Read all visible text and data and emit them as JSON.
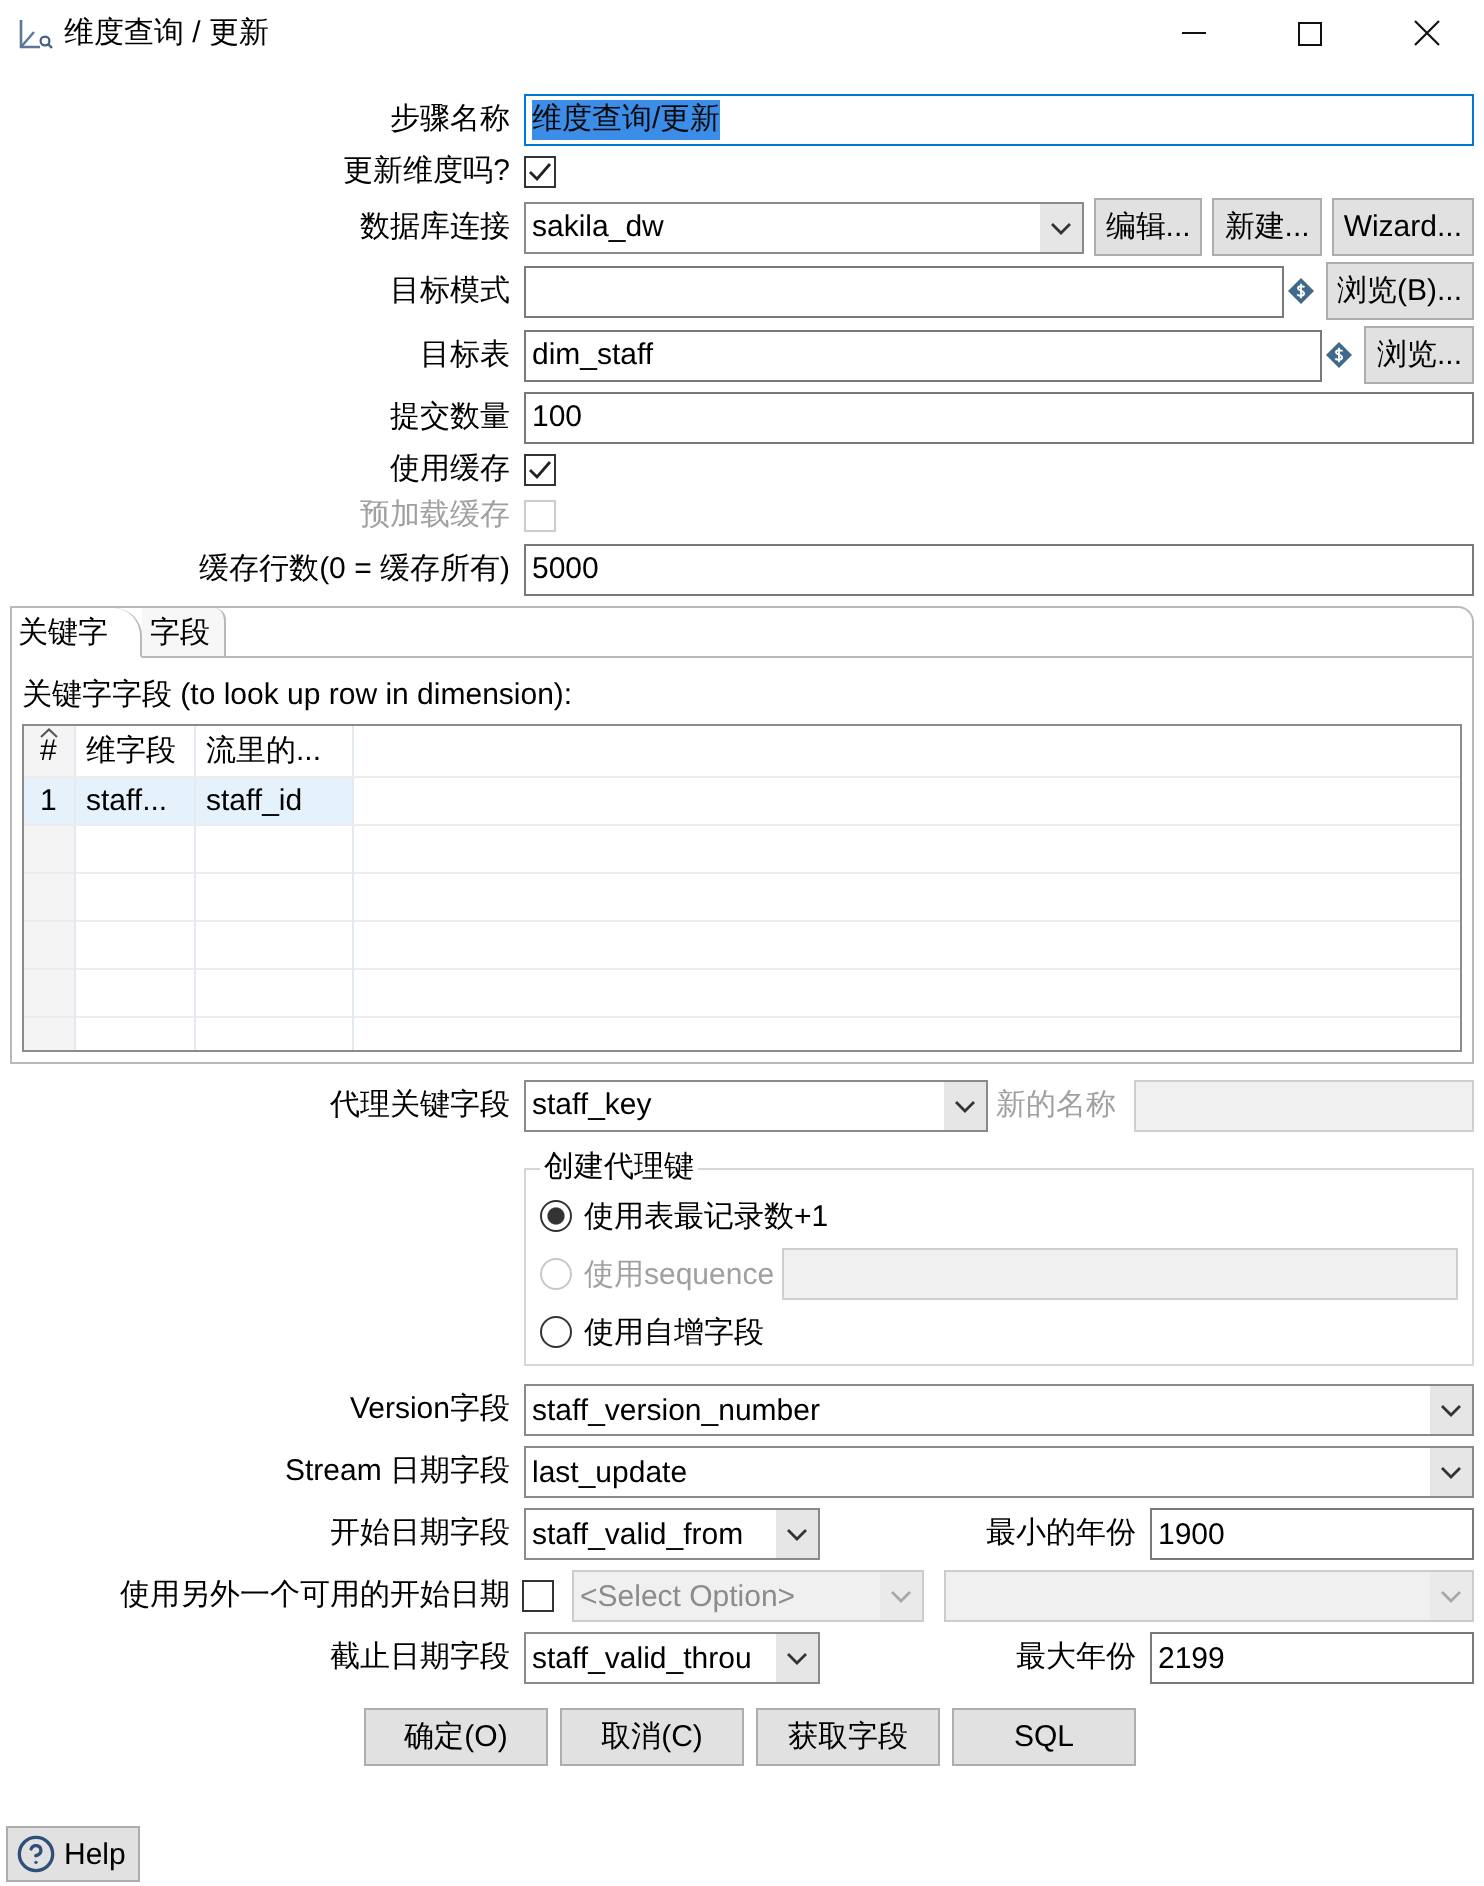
{
  "window": {
    "title": "维度查询 / 更新"
  },
  "settings": [
    {
      "kind": "text",
      "label": "步骤名称",
      "value": "维度查询/更新",
      "focused": true
    },
    {
      "kind": "checkbox",
      "label": "更新维度吗?",
      "checked": true,
      "disabled": false
    },
    {
      "kind": "combo",
      "label": "数据库连接",
      "value": "sakila_dw",
      "buttons": [
        "编辑...",
        "新建...",
        "Wizard..."
      ]
    },
    {
      "kind": "text",
      "label": "目标模式",
      "variable": true,
      "buttons": [
        "浏览(B)..."
      ]
    },
    {
      "kind": "text",
      "label": "目标表",
      "value": "dim_staff",
      "variable": true,
      "buttons": [
        "浏览..."
      ]
    },
    {
      "kind": "text",
      "label": "提交数量",
      "value": "100"
    },
    {
      "kind": "checkbox",
      "label": "使用缓存",
      "checked": true,
      "disabled": false
    },
    {
      "kind": "checkbox",
      "label": "预加载缓存",
      "checked": false,
      "disabled": true
    },
    {
      "kind": "text",
      "label": "缓存行数(0 = 缓存所有)",
      "value": "5000"
    }
  ],
  "tabs": [
    {
      "label": "关键字",
      "selected": true
    },
    {
      "label": "字段",
      "selected": false
    }
  ],
  "key_panel": {
    "caption": "关键字字段 (to look up row in dimension):",
    "table": {
      "columns": [
        "#",
        "维字段",
        "流里的..."
      ],
      "rows": [
        {
          "cells": [
            "1",
            "staff...",
            "staff_id"
          ],
          "selected": true
        }
      ]
    }
  },
  "surrogate_key": {
    "label": "代理关键字段",
    "value": "staff_key",
    "new_name": {
      "label": "新的名称",
      "disabled": true
    }
  },
  "key_creation": {
    "title": "创建代理键",
    "options": [
      {
        "kind": "plain",
        "label": "使用表最记录数+1",
        "selected": true,
        "disabled": false
      },
      {
        "kind": "sequence",
        "label": "使用sequence",
        "selected": false,
        "disabled": true
      },
      {
        "kind": "plain",
        "label": "使用自增字段",
        "selected": false,
        "disabled": false
      }
    ]
  },
  "version_field": {
    "label": "Version字段",
    "value": "staff_version_number"
  },
  "stream_date_field": {
    "label": "Stream 日期字段",
    "value": "last_update"
  },
  "start_date_field": {
    "label": "开始日期字段",
    "value": "staff_valid_from",
    "year": {
      "label": "最小的年份",
      "value": "1900"
    }
  },
  "alt_start_date": {
    "label": "使用另外一个可用的开始日期",
    "checked": false,
    "type": {
      "value": "<Select Option>",
      "disabled": true
    },
    "field": {
      "disabled": true
    }
  },
  "end_date_field": {
    "label": "截止日期字段",
    "value": "staff_valid_throu",
    "year": {
      "label": "最大年份",
      "value": "2199"
    }
  },
  "buttons": [
    "确定(O)",
    "取消(C)",
    "获取字段",
    "SQL"
  ],
  "help_button": {
    "label": "Help"
  }
}
